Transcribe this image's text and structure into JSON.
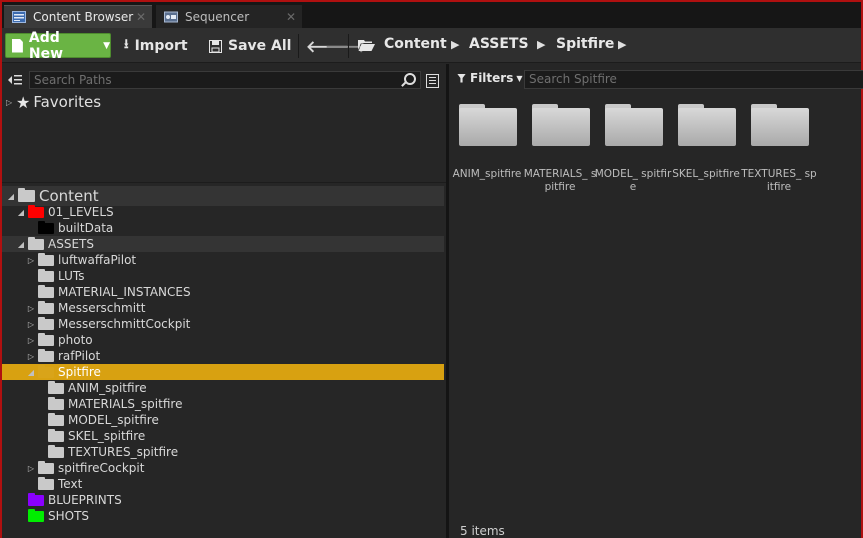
{
  "tabs": [
    {
      "label": "Content Browser",
      "icon": "content-browser-icon",
      "active": true
    },
    {
      "label": "Sequencer",
      "icon": "sequencer-icon",
      "active": false
    }
  ],
  "toolbar": {
    "add_new": "Add New",
    "import": "Import",
    "save_all": "Save All",
    "breadcrumbs": [
      "Content",
      "ASSETS",
      "Spitfire"
    ]
  },
  "sources": {
    "search_placeholder": "Search Paths",
    "favorites_label": "Favorites",
    "tree": [
      {
        "label": "Content",
        "depth": 0,
        "expander": "open",
        "color": "#c9c9c9",
        "root": true
      },
      {
        "label": "01_LEVELS",
        "depth": 1,
        "expander": "open",
        "color": "#ff0000"
      },
      {
        "label": "builtData",
        "depth": 2,
        "expander": "",
        "color": "#000000"
      },
      {
        "label": "ASSETS",
        "depth": 1,
        "expander": "open",
        "color": "#c9c9c9"
      },
      {
        "label": "luftwaffaPilot",
        "depth": 2,
        "expander": "closed",
        "color": "#c9c9c9"
      },
      {
        "label": "LUTs",
        "depth": 2,
        "expander": "",
        "color": "#c9c9c9"
      },
      {
        "label": "MATERIAL_INSTANCES",
        "depth": 2,
        "expander": "",
        "color": "#c9c9c9"
      },
      {
        "label": "Messerschmitt",
        "depth": 2,
        "expander": "closed",
        "color": "#c9c9c9"
      },
      {
        "label": "MesserschmittCockpit",
        "depth": 2,
        "expander": "closed",
        "color": "#c9c9c9"
      },
      {
        "label": "photo",
        "depth": 2,
        "expander": "closed",
        "color": "#c9c9c9"
      },
      {
        "label": "rafPilot",
        "depth": 2,
        "expander": "closed",
        "color": "#c9c9c9"
      },
      {
        "label": "Spitfire",
        "depth": 2,
        "expander": "open",
        "color": "#d9a419",
        "selected": true
      },
      {
        "label": "ANIM_spitfire",
        "depth": 3,
        "expander": "",
        "color": "#c9c9c9"
      },
      {
        "label": "MATERIALS_spitfire",
        "depth": 3,
        "expander": "",
        "color": "#c9c9c9"
      },
      {
        "label": "MODEL_spitfire",
        "depth": 3,
        "expander": "",
        "color": "#c9c9c9"
      },
      {
        "label": "SKEL_spitfire",
        "depth": 3,
        "expander": "",
        "color": "#c9c9c9"
      },
      {
        "label": "TEXTURES_spitfire",
        "depth": 3,
        "expander": "",
        "color": "#c9c9c9"
      },
      {
        "label": "spitfireCockpit",
        "depth": 2,
        "expander": "closed",
        "color": "#c9c9c9"
      },
      {
        "label": "Text",
        "depth": 2,
        "expander": "",
        "color": "#c9c9c9"
      },
      {
        "label": "BLUEPRINTS",
        "depth": 1,
        "expander": "",
        "color": "#8a00ff"
      },
      {
        "label": "SHOTS",
        "depth": 1,
        "expander": "",
        "color": "#00ee00"
      }
    ]
  },
  "assets": {
    "filters_label": "Filters",
    "search_placeholder": "Search Spitfire",
    "items": [
      {
        "label": "ANIM_spitfire"
      },
      {
        "label": "MATERIALS_ spitfire"
      },
      {
        "label": "MODEL_ spitfire"
      },
      {
        "label": "SKEL_spitfire"
      },
      {
        "label": "TEXTURES_ spitfire"
      }
    ],
    "count_label": "5 items"
  }
}
